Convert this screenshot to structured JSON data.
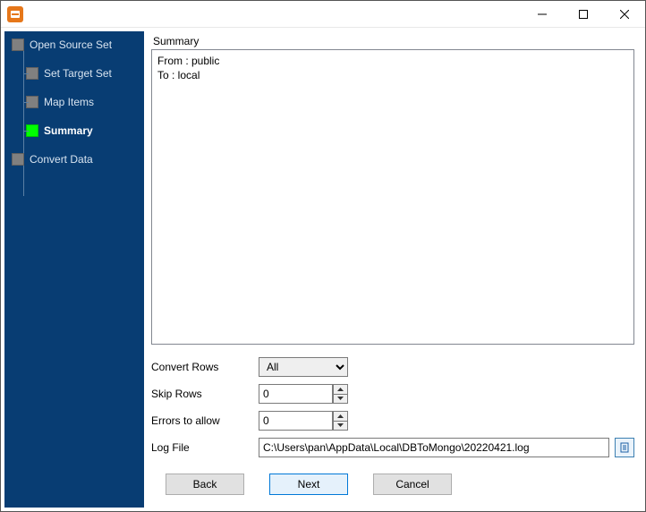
{
  "titlebar": {
    "app_name": ""
  },
  "sidebar": {
    "items": [
      {
        "label": "Open Source Set",
        "level": 0,
        "active": false
      },
      {
        "label": "Set Target Set",
        "level": 1,
        "active": false
      },
      {
        "label": "Map Items",
        "level": 1,
        "active": false
      },
      {
        "label": "Summary",
        "level": 1,
        "active": true
      },
      {
        "label": "Convert Data",
        "level": 0,
        "active": false
      }
    ]
  },
  "main": {
    "group_label": "Summary",
    "summary_text": "From : public\nTo : local",
    "rows": {
      "convert_rows": {
        "label": "Convert Rows",
        "value": "All"
      },
      "skip_rows": {
        "label": "Skip Rows",
        "value": "0"
      },
      "errors": {
        "label": "Errors to allow",
        "value": "0"
      },
      "log_file": {
        "label": "Log File",
        "value": "C:\\Users\\pan\\AppData\\Local\\DBToMongo\\20220421.log"
      }
    }
  },
  "buttons": {
    "back": "Back",
    "next": "Next",
    "cancel": "Cancel"
  }
}
